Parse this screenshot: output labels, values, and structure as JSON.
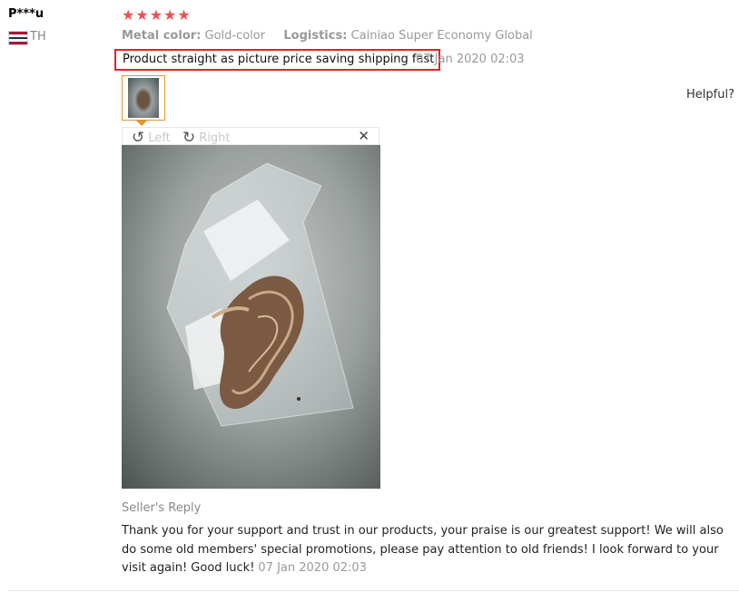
{
  "reviewer": {
    "name": "P***u",
    "country_code": "TH",
    "flag_icon": "thailand-flag-icon"
  },
  "rating": {
    "stars": 5,
    "max": 5,
    "glyphs": "★★★★★",
    "color": "#ef4f4f"
  },
  "attributes": {
    "metal_color_label": "Metal color:",
    "metal_color_value": "Gold-color",
    "logistics_label": "Logistics:",
    "logistics_value": "Cainiao Super Economy Global"
  },
  "review": {
    "text": "Product straight as picture price saving shipping fast",
    "date": "07 Jan 2020 02:03",
    "highlight_color": "#e32323"
  },
  "helpful_label": "Helpful?",
  "viewer": {
    "rotate_left_label": "Left",
    "rotate_right_label": "Right",
    "close_glyph": "✕"
  },
  "seller_reply": {
    "title": "Seller's Reply",
    "text": "Thank you for your support and trust in our products, your praise is our greatest support! We will also do some old members' special promotions, please pay attention to old friends! I look forward to your visit again! Good luck!",
    "date": "07 Jan 2020 02:03"
  }
}
